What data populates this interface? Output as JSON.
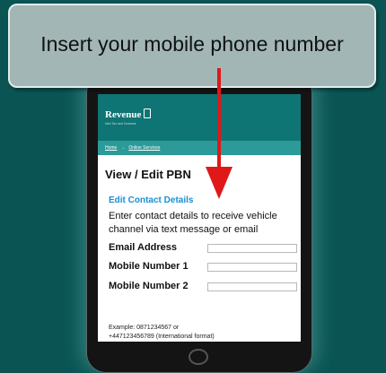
{
  "callout": {
    "text": "Insert your mobile phone number"
  },
  "site": {
    "brand": "Revenue",
    "tagline": "Irish Tax and Customs",
    "breadcrumb": {
      "home": "Home",
      "arrow": "→",
      "current": "Online Services"
    }
  },
  "page": {
    "title": "View / Edit PBN",
    "section_title": "Edit Contact Details",
    "intro": "Enter contact details to receive vehicle channel via text message or email",
    "fields": [
      {
        "label": "Email Address",
        "value": ""
      },
      {
        "label": "Mobile Number 1",
        "value": ""
      },
      {
        "label": "Mobile Number 2",
        "value": ""
      }
    ],
    "example_line1": "Example: 0871234567 or",
    "example_line2": "+447123456789 (International format)"
  },
  "colors": {
    "background": "#0a5454",
    "header": "#0f7474",
    "breadcrumb_bar": "#2c9a98",
    "section_title": "#1a8fd0",
    "arrow": "#e01818",
    "callout": "#a2b6b6"
  }
}
